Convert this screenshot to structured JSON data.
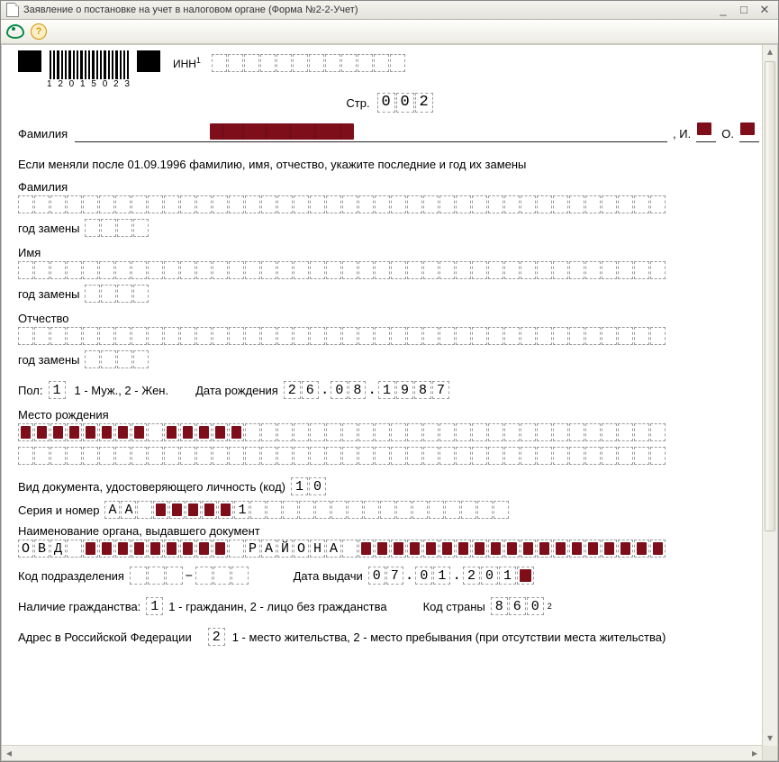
{
  "window": {
    "title": "Заявление о постановке на учет в налоговом органе (Форма №2-2-Учет)"
  },
  "toolbar": {
    "preview_tooltip": "Просмотр",
    "help_tooltip": "Справка"
  },
  "header": {
    "barcode_digits": "1 2 0 1 5 0 2 3",
    "inn_label": "ИНН",
    "inn_sup": "1",
    "page_label": "Стр.",
    "page": [
      "0",
      "0",
      "2"
    ]
  },
  "fio_line": {
    "surname_label": "Фамилия",
    "initial_i_label": ", И.",
    "initial_o_label": "О."
  },
  "previous_names": {
    "instruction": "Если меняли после 01.09.1996 фамилию, имя, отчество, укажите последние и год их замены",
    "surname_label": "Фамилия",
    "surname_year_label": "год замены",
    "name_label": "Имя",
    "name_year_label": "год замены",
    "patronymic_label": "Отчество",
    "patronymic_year_label": "год замены"
  },
  "sex_birth": {
    "sex_label": "Пол:",
    "sex_value": "1",
    "sex_legend": "1 - Муж., 2 - Жен.",
    "birth_label": "Дата рождения",
    "birth_day": [
      "2",
      "6"
    ],
    "birth_month": [
      "0",
      "8"
    ],
    "birth_year": [
      "1",
      "9",
      "8",
      "7"
    ]
  },
  "birth_place": {
    "label": "Место рождения"
  },
  "doc": {
    "type_label": "Вид документа, удостоверяющего личность  (код)",
    "type_code": [
      "1",
      "0"
    ],
    "series_label": "Серия и номер",
    "series_visible": [
      "А",
      "А"
    ],
    "series_tail_visible": [
      "1"
    ],
    "issuer_label": "Наименование органа, выдавшего документ",
    "issuer_prefix": [
      "О",
      "В",
      "Д"
    ],
    "issuer_word": [
      "Р",
      "А",
      "Й",
      "О",
      "Н",
      "А"
    ],
    "subdiv_label": "Код подразделения",
    "subdiv_dash": "–",
    "issue_date_label": "Дата выдачи",
    "issue_day": [
      "0",
      "7"
    ],
    "issue_month": [
      "0",
      "1"
    ],
    "issue_year": [
      "2",
      "0",
      "1"
    ]
  },
  "citizenship": {
    "presence_label": "Наличие гражданства:",
    "presence_value": "1",
    "presence_legend": "1 - гражданин, 2 - лицо без гражданства",
    "country_label": "Код страны",
    "country_code": [
      "8",
      "6",
      "0"
    ],
    "country_sup": "2"
  },
  "address": {
    "label": "Адрес в Российской Федерации",
    "value": "2",
    "legend": "1 - место жительства, 2 - место пребывания (при отсутствии места жительства)"
  }
}
